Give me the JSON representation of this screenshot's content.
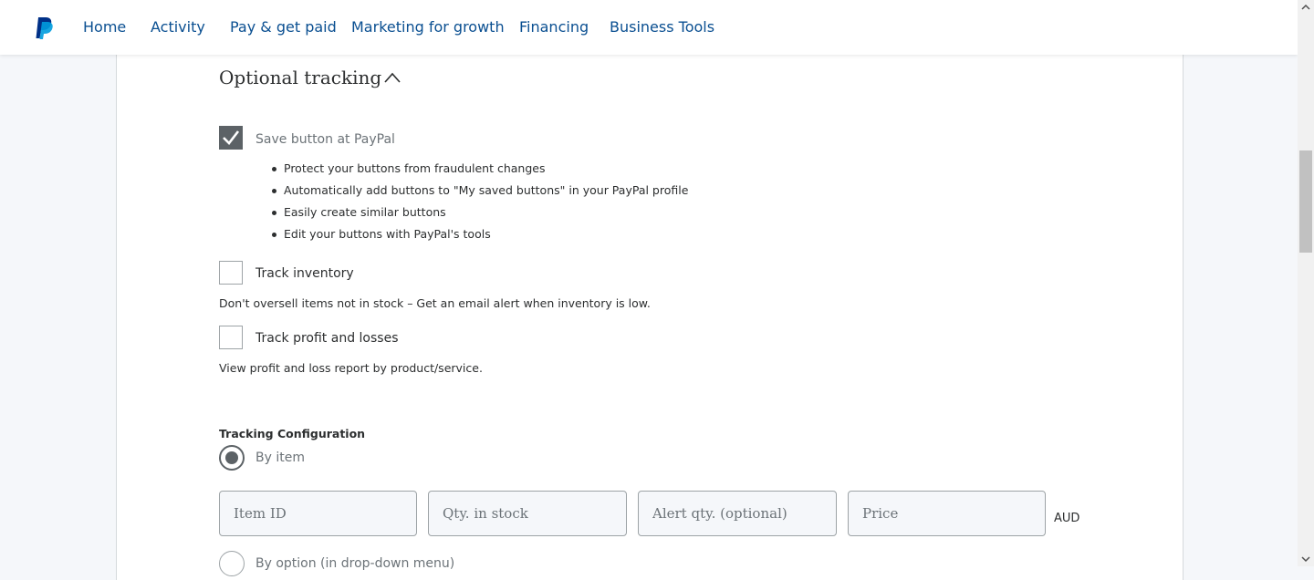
{
  "nav": {
    "logo_icon": "paypal-logo-icon",
    "items": [
      {
        "label": "Home"
      },
      {
        "label": "Activity"
      },
      {
        "label": "Pay & get paid"
      },
      {
        "label": "Marketing for growth"
      },
      {
        "label": "Financing"
      },
      {
        "label": "Business Tools"
      }
    ]
  },
  "section": {
    "title": "Optional tracking",
    "toggle_icon": "chevron-up-icon"
  },
  "save_button": {
    "checked": true,
    "label": "Save button at PayPal",
    "benefits": [
      "Protect your buttons from fraudulent changes",
      "Automatically add buttons to \"My saved buttons\" in your PayPal profile",
      "Easily create similar buttons",
      "Edit your buttons with PayPal's tools"
    ]
  },
  "track_inventory": {
    "checked": false,
    "label": "Track inventory",
    "description": "Don't oversell items not in stock – Get an email alert when inventory is low."
  },
  "track_profit": {
    "checked": false,
    "label": "Track profit and losses",
    "description": "View profit and loss report by product/service."
  },
  "tracking_config": {
    "heading": "Tracking Configuration",
    "options": [
      {
        "label": "By item",
        "selected": true
      },
      {
        "label": "By option (in drop-down menu)",
        "selected": false
      }
    ],
    "fields": [
      {
        "placeholder": "Item ID",
        "value": ""
      },
      {
        "placeholder": "Qty. in stock",
        "value": ""
      },
      {
        "placeholder": "Alert qty. (optional)",
        "value": ""
      },
      {
        "placeholder": "Price",
        "value": ""
      }
    ],
    "currency": "AUD"
  },
  "colors": {
    "nav_link": "#0a4f91",
    "paypal_dark_blue": "#003087",
    "paypal_light_blue": "#009cde",
    "checkbox_checked": "#5c6266",
    "page_bg": "#f5f7fa"
  }
}
